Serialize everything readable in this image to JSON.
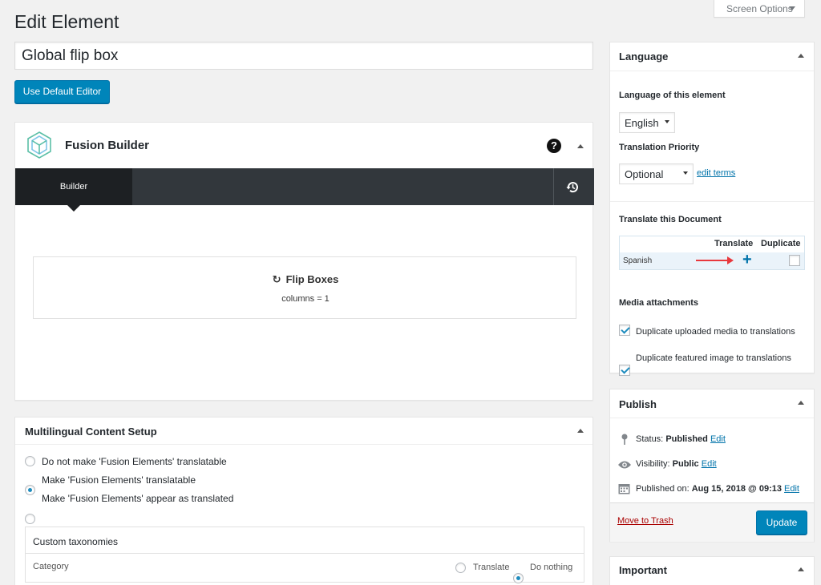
{
  "header": {
    "page_title": "Edit Element",
    "screen_options": "Screen Options"
  },
  "title_input": {
    "value": "Global flip box"
  },
  "use_default_editor": "Use Default Editor",
  "builder": {
    "title": "Fusion Builder",
    "tab_label": "Builder",
    "element_title": "Flip Boxes",
    "element_params": "columns = 1"
  },
  "multilingual": {
    "title": "Multilingual Content Setup",
    "options": [
      {
        "label": "Do not make 'Fusion Elements' translatable",
        "selected": false
      },
      {
        "label": "Make 'Fusion Elements' translatable",
        "selected": true
      },
      {
        "label": "Make 'Fusion Elements' appear as translated",
        "selected": false
      }
    ],
    "taxonomies_title": "Custom taxonomies",
    "taxonomy_row": {
      "name": "Category",
      "translate_label": "Translate",
      "do_nothing_label": "Do nothing",
      "selected": "do_nothing"
    }
  },
  "language": {
    "title": "Language",
    "lang_of_element_label": "Language of this element",
    "lang_value": "English",
    "priority_label": "Translation Priority",
    "priority_value": "Optional",
    "edit_terms": "edit terms",
    "translate_doc_label": "Translate this Document",
    "col_translate": "Translate",
    "col_duplicate": "Duplicate",
    "row_language": "Spanish",
    "media_label": "Media attachments",
    "media_opt1": "Duplicate uploaded media to translations",
    "media_opt2": "Duplicate featured image to translations",
    "accent_color": "#0073aa",
    "arrow_color": "#e8383d"
  },
  "publish": {
    "title": "Publish",
    "status_label": "Status:",
    "status_value": "Published",
    "visibility_label": "Visibility:",
    "visibility_value": "Public",
    "published_label": "Published on:",
    "published_value": "Aug 15, 2018 @ 09:13",
    "edit": "Edit",
    "move_to_trash": "Move to Trash",
    "update": "Update"
  },
  "important": {
    "title": "Important"
  }
}
